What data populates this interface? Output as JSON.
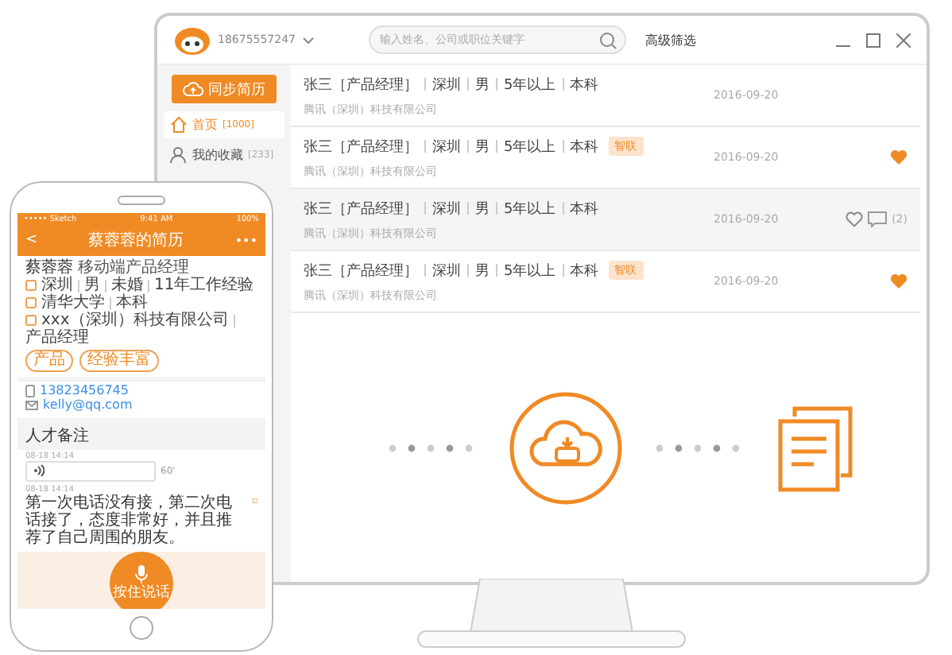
{
  "monitor": {
    "account": "18675557247",
    "search": {
      "placeholder": "输入姓名、公司或职位关键字"
    },
    "filter_link": "高级筛选",
    "sidebar": {
      "sync_button": "同步简历",
      "items": [
        {
          "kind": "home",
          "label": "首页",
          "count": "[1000]",
          "selected": true
        },
        {
          "kind": "person",
          "label": "我的收藏",
          "count": "[233]",
          "selected": false
        }
      ]
    },
    "rows": [
      {
        "fields": [
          "张三［产品经理］",
          "深圳",
          "男",
          "5年以上",
          "本科"
        ],
        "company": "腾讯（深圳）科技有限公司",
        "date": "2016-09-20",
        "favorited": false,
        "hovered": false
      },
      {
        "fields": [
          "张三［产品经理］",
          "深圳",
          "男",
          "5年以上",
          "本科"
        ],
        "badge": "智联",
        "company": "腾讯（深圳）科技有限公司",
        "date": "2016-09-20",
        "favorited": true,
        "hovered": false
      },
      {
        "fields": [
          "张三［产品经理］",
          "深圳",
          "男",
          "5年以上",
          "本科"
        ],
        "company": "腾讯（深圳）科技有限公司",
        "date": "2016-09-20",
        "favorited": false,
        "hovered": true,
        "comments": "(2)"
      },
      {
        "fields": [
          "张三［产品经理］",
          "深圳",
          "男",
          "5年以上",
          "本科"
        ],
        "badge": "智联",
        "company": "腾讯（深圳）科技有限公司",
        "date": "2016-09-20",
        "favorited": true,
        "hovered": false
      }
    ]
  },
  "phone": {
    "status": {
      "carrier": "••••• Sketch",
      "time": "9:41 AM",
      "battery": "100%"
    },
    "nav": {
      "back": "<",
      "title": "蔡蓉蓉的简历",
      "more": "•••"
    },
    "profile": {
      "name": "蔡蓉蓉",
      "title": "移动端产品经理",
      "lines": [
        [
          "深圳",
          "男",
          "未婚",
          "11年工作经验"
        ],
        [
          "清华大学",
          "本科"
        ],
        [
          "xxx（深圳）科技有限公司",
          "产品经理"
        ]
      ],
      "tags": [
        "产品",
        "经验丰富"
      ]
    },
    "contacts": [
      {
        "kind": "phone",
        "value": "13823456745"
      },
      {
        "kind": "email",
        "value": "kelly@qq.com"
      }
    ],
    "notes_title": "人才备注",
    "notes": [
      {
        "kind": "voice",
        "time": "08-18 14:14",
        "duration": "60'"
      },
      {
        "kind": "text",
        "time": "08-18 14:14",
        "text": "第一次电话没有接，第二次电话接了，态度非常好，并且推荐了自己周围的朋友。"
      }
    ],
    "record_button": "按住说话"
  }
}
